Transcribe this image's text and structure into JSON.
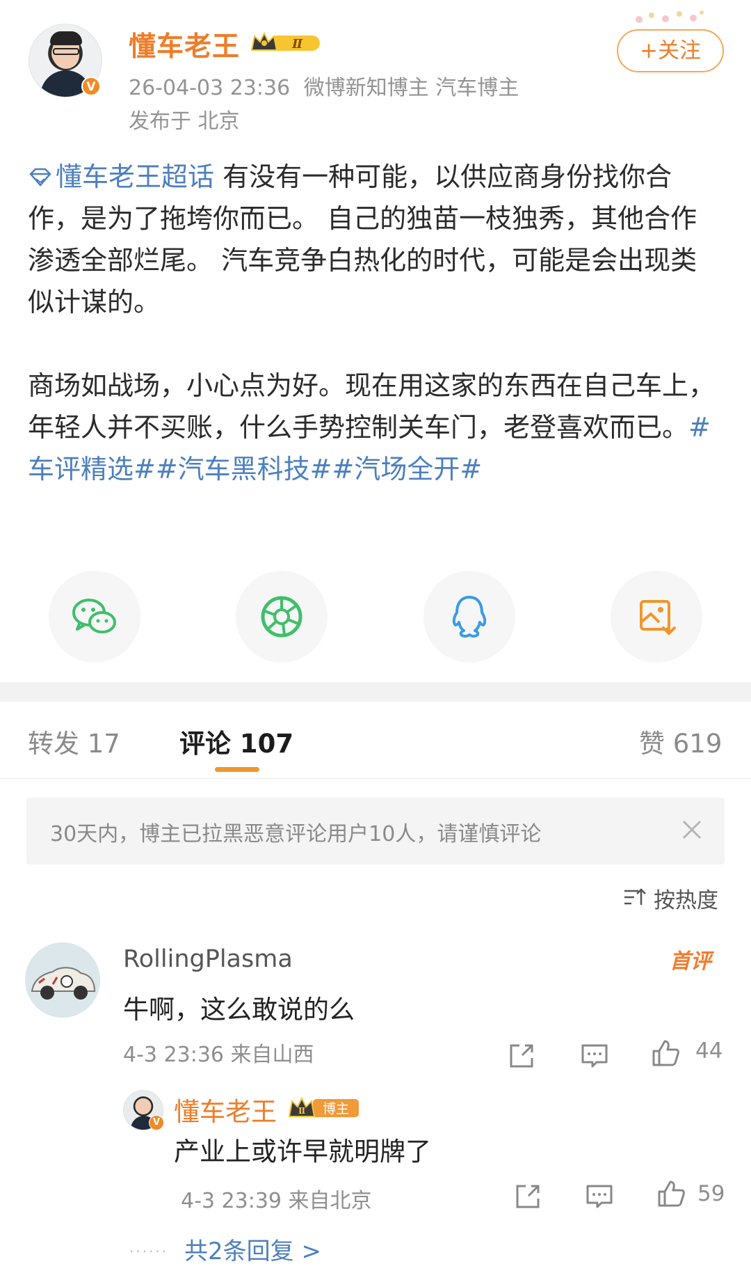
{
  "post": {
    "author": {
      "name": "懂车老王",
      "level_badge": "Ⅱ",
      "verified": "V"
    },
    "date": "26-04-03 23:36",
    "meta_tags": "微博新知博主 汽车博主",
    "location": "发布于 北京",
    "follow_label": "+关注",
    "topic": "懂车老王超话",
    "paragraph1": "有没有一种可能，以供应商身份找你合作，是为了拖垮你而已。 自己的独苗一枝独秀，其他合作渗透全部烂尾。 汽车竞争白热化的时代，可能是会出现类似计谋的。",
    "paragraph2_text": "商场如战场，小心点为好。现在用这家的东西在自己车上，年轻人并不买账，什么手势控制关车门，老登喜欢而已。",
    "hashtags": "#车评精选##汽车黑科技##汽场全开#"
  },
  "share": {
    "icons": [
      "wechat-icon",
      "moments-icon",
      "qq-icon",
      "save-image-icon"
    ]
  },
  "tabs": {
    "repost": "转发 17",
    "comments": "评论 107",
    "likes": "赞 619"
  },
  "notice": {
    "text": "30天内，博主已拉黑恶意评论用户10人，请谨慎评论"
  },
  "sort": {
    "label": "按热度"
  },
  "comments": [
    {
      "username": "RollingPlasma",
      "text": "牛啊，这么敢说的么",
      "badge": "首评",
      "time": "4-3 23:36 来自山西",
      "likes": "44",
      "reply": {
        "username": "懂车老王",
        "badge": "博主",
        "level": "Ⅱ",
        "text": "产业上或许早就明牌了",
        "time": "4-3 23:39 来自北京",
        "likes": "59"
      },
      "more_replies": "共2条回复 >"
    }
  ],
  "colors": {
    "brand_orange": "#ee7d2a",
    "link_blue": "#4d7fbf",
    "wechat_green": "#3fbf6a",
    "qq_blue": "#3a9be6",
    "save_orange": "#f0962a"
  }
}
